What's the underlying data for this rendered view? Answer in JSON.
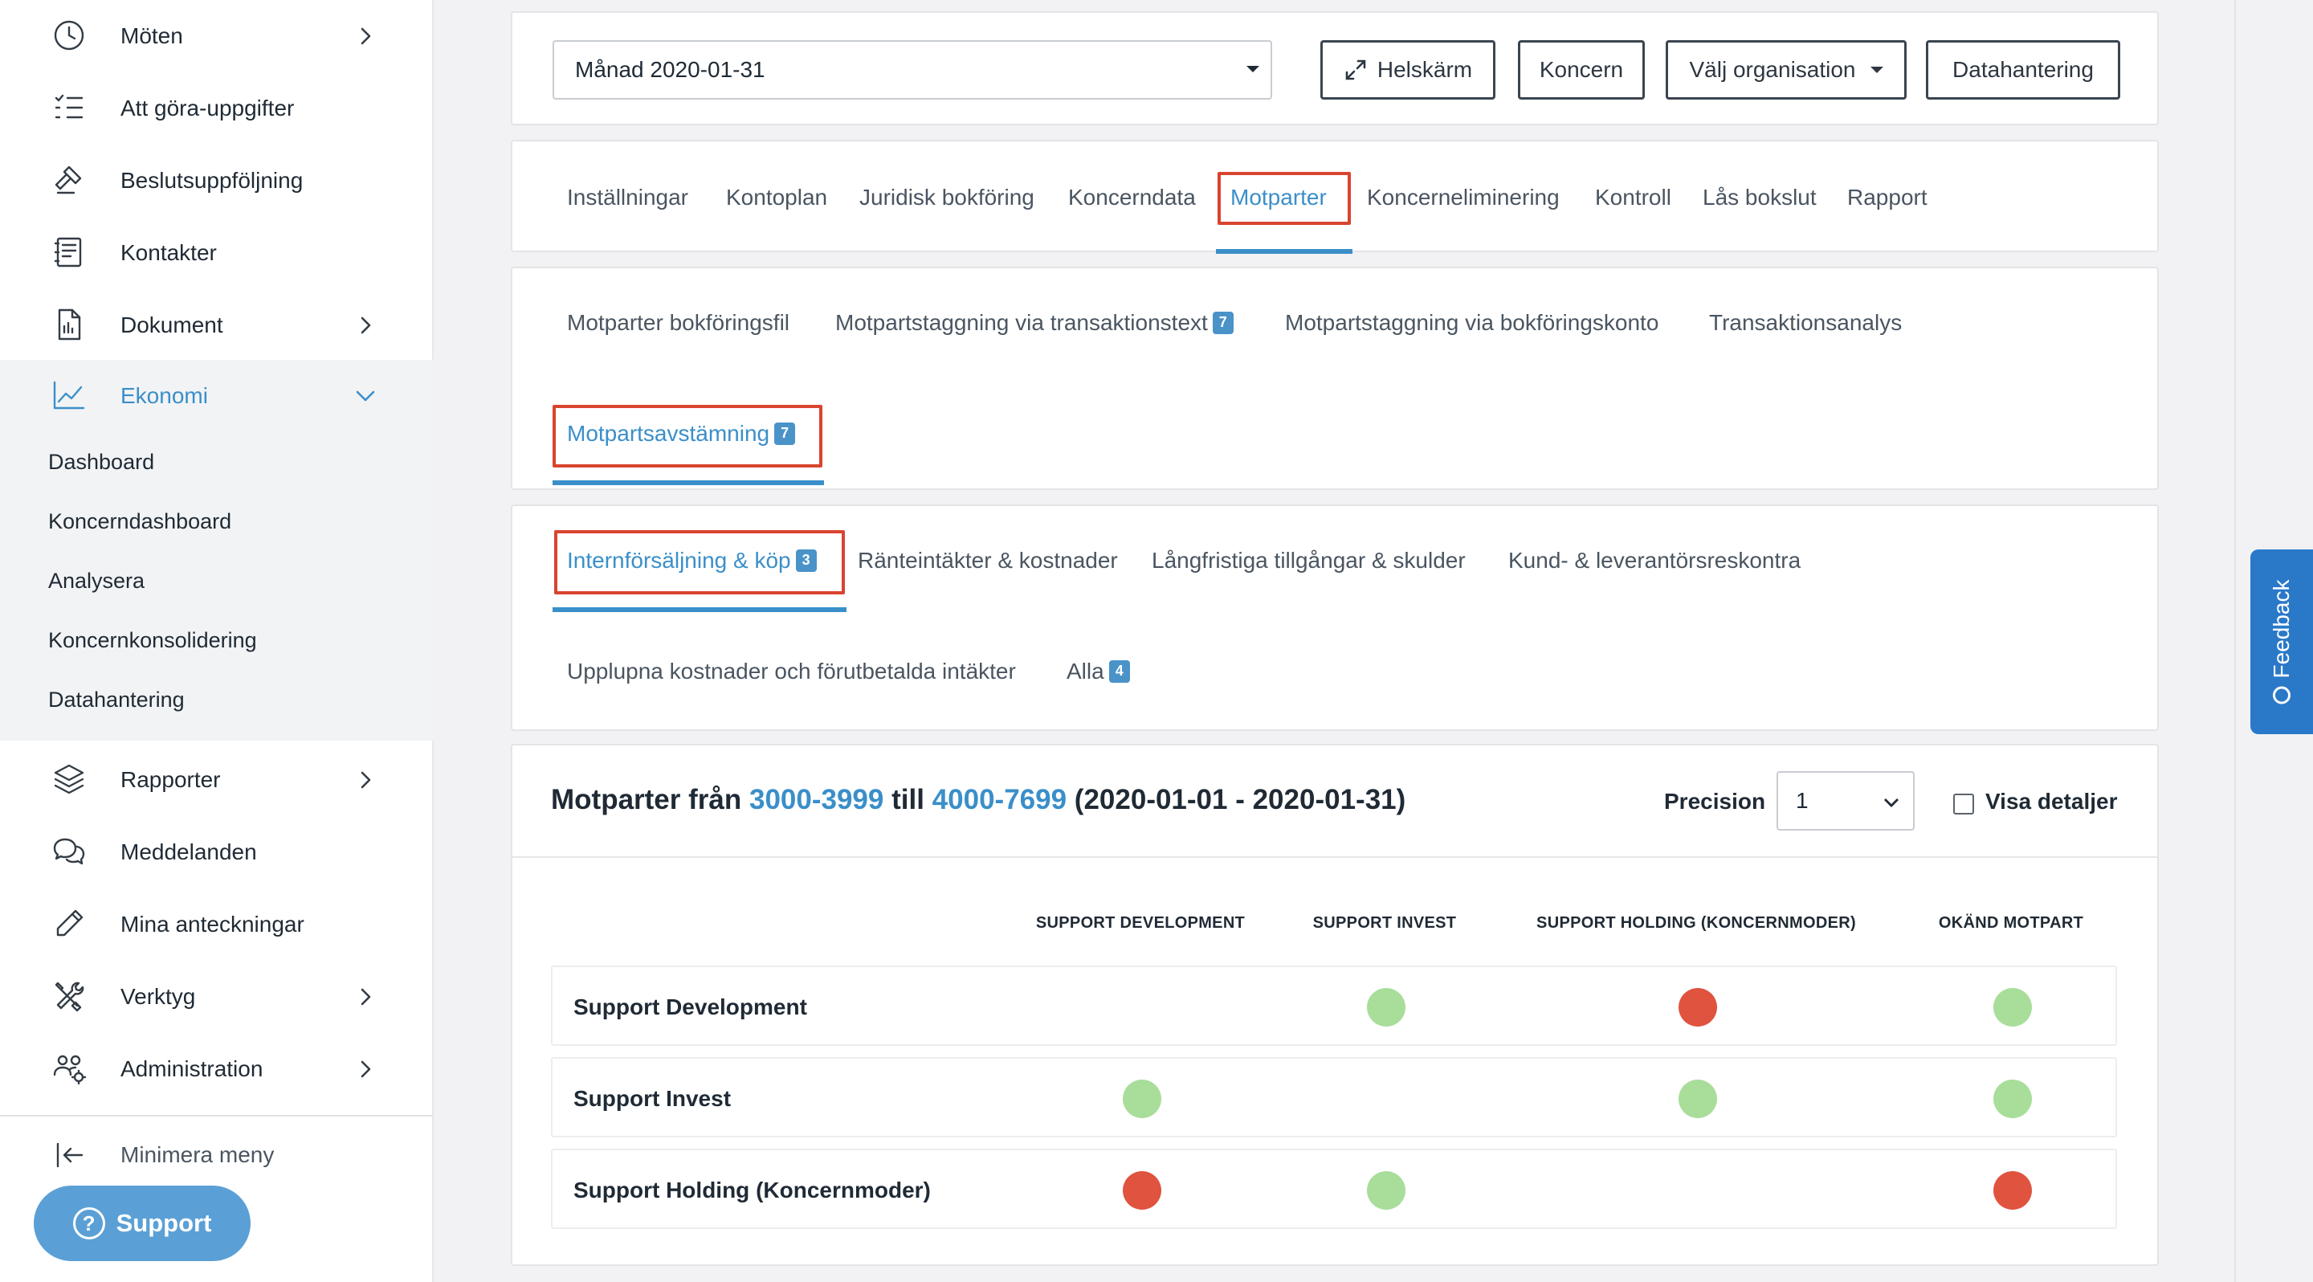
{
  "sidebar": {
    "items": [
      {
        "label": "Möten",
        "icon": "clock-icon",
        "chevron": true
      },
      {
        "label": "Att göra-uppgifter",
        "icon": "checklist-icon",
        "chevron": false
      },
      {
        "label": "Beslutsuppföljning",
        "icon": "gavel-icon",
        "chevron": false
      },
      {
        "label": "Kontakter",
        "icon": "address-book-icon",
        "chevron": false
      },
      {
        "label": "Dokument",
        "icon": "document-icon",
        "chevron": true
      },
      {
        "label": "Ekonomi",
        "icon": "line-chart-icon",
        "chevron": true,
        "expanded": true
      },
      {
        "label": "Rapporter",
        "icon": "layers-icon",
        "chevron": true
      },
      {
        "label": "Meddelanden",
        "icon": "chat-bubbles-icon",
        "chevron": false
      },
      {
        "label": "Mina anteckningar",
        "icon": "pencil-icon",
        "chevron": false
      },
      {
        "label": "Verktyg",
        "icon": "tools-icon",
        "chevron": true
      },
      {
        "label": "Administration",
        "icon": "users-gear-icon",
        "chevron": true
      }
    ],
    "ekonomi_sub": [
      "Dashboard",
      "Koncerndashboard",
      "Analysera",
      "Koncernkonsolidering",
      "Datahantering"
    ],
    "minimize_label": "Minimera meny",
    "support_label": "Support"
  },
  "toolbar": {
    "period_value": "Månad 2020-01-31",
    "fullscreen_label": "Helskärm",
    "group_label": "Koncern",
    "org_label": "Välj organisation",
    "data_label": "Datahantering"
  },
  "main_tabs": {
    "items": [
      "Inställningar",
      "Kontoplan",
      "Juridisk bokföring",
      "Koncerndata",
      "Motparter",
      "Koncerneliminering",
      "Kontroll",
      "Lås bokslut",
      "Rapport"
    ],
    "active": "Motparter"
  },
  "sub_tabs": {
    "items": [
      {
        "label": "Motparter bokföringsfil",
        "badge": ""
      },
      {
        "label": "Motpartstaggning via transaktionstext",
        "badge": "7"
      },
      {
        "label": "Motpartstaggning via bokföringskonto",
        "badge": ""
      },
      {
        "label": "Transaktionsanalys",
        "badge": ""
      },
      {
        "label": "Motpartsavstämning",
        "badge": "7"
      }
    ],
    "active": "Motpartsavstämning"
  },
  "category_tabs": {
    "items": [
      {
        "label": "Internförsäljning & köp",
        "badge": "3"
      },
      {
        "label": "Ränteintäkter & kostnader",
        "badge": ""
      },
      {
        "label": "Långfristiga tillgångar & skulder",
        "badge": ""
      },
      {
        "label": "Kund- & leverantörsreskontra",
        "badge": ""
      },
      {
        "label": "Upplupna kostnader och förutbetalda intäkter",
        "badge": ""
      },
      {
        "label": "Alla",
        "badge": "4"
      }
    ],
    "active": "Internförsäljning & köp"
  },
  "matrix": {
    "title_prefix": "Motparter från",
    "range_from": "3000-3999",
    "title_mid": "till",
    "range_to": "4000-7699",
    "period": "(2020-01-01 - 2020-01-31)",
    "precision_label": "Precision",
    "precision_value": "1",
    "details_label": "Visa detaljer",
    "columns": [
      "SUPPORT DEVELOPMENT",
      "SUPPORT INVEST",
      "SUPPORT HOLDING (KONCERNMODER)",
      "OKÄND MOTPART"
    ],
    "rows": [
      {
        "label": "Support Development",
        "status": [
          "",
          "ok",
          "error",
          "ok"
        ]
      },
      {
        "label": "Support Invest",
        "status": [
          "ok",
          "",
          "ok",
          "ok"
        ]
      },
      {
        "label": "Support Holding (Koncernmoder)",
        "status": [
          "error",
          "ok",
          "",
          "error"
        ]
      }
    ],
    "colors": {
      "ok": "#a8dd9a",
      "error": "#e0533f"
    }
  },
  "feedback_label": "Feedback",
  "colors": {
    "accent": "#3a8fc9",
    "highlight_box": "#d9442f",
    "support_button": "#5aa0d6",
    "feedback": "#2a79c9"
  }
}
